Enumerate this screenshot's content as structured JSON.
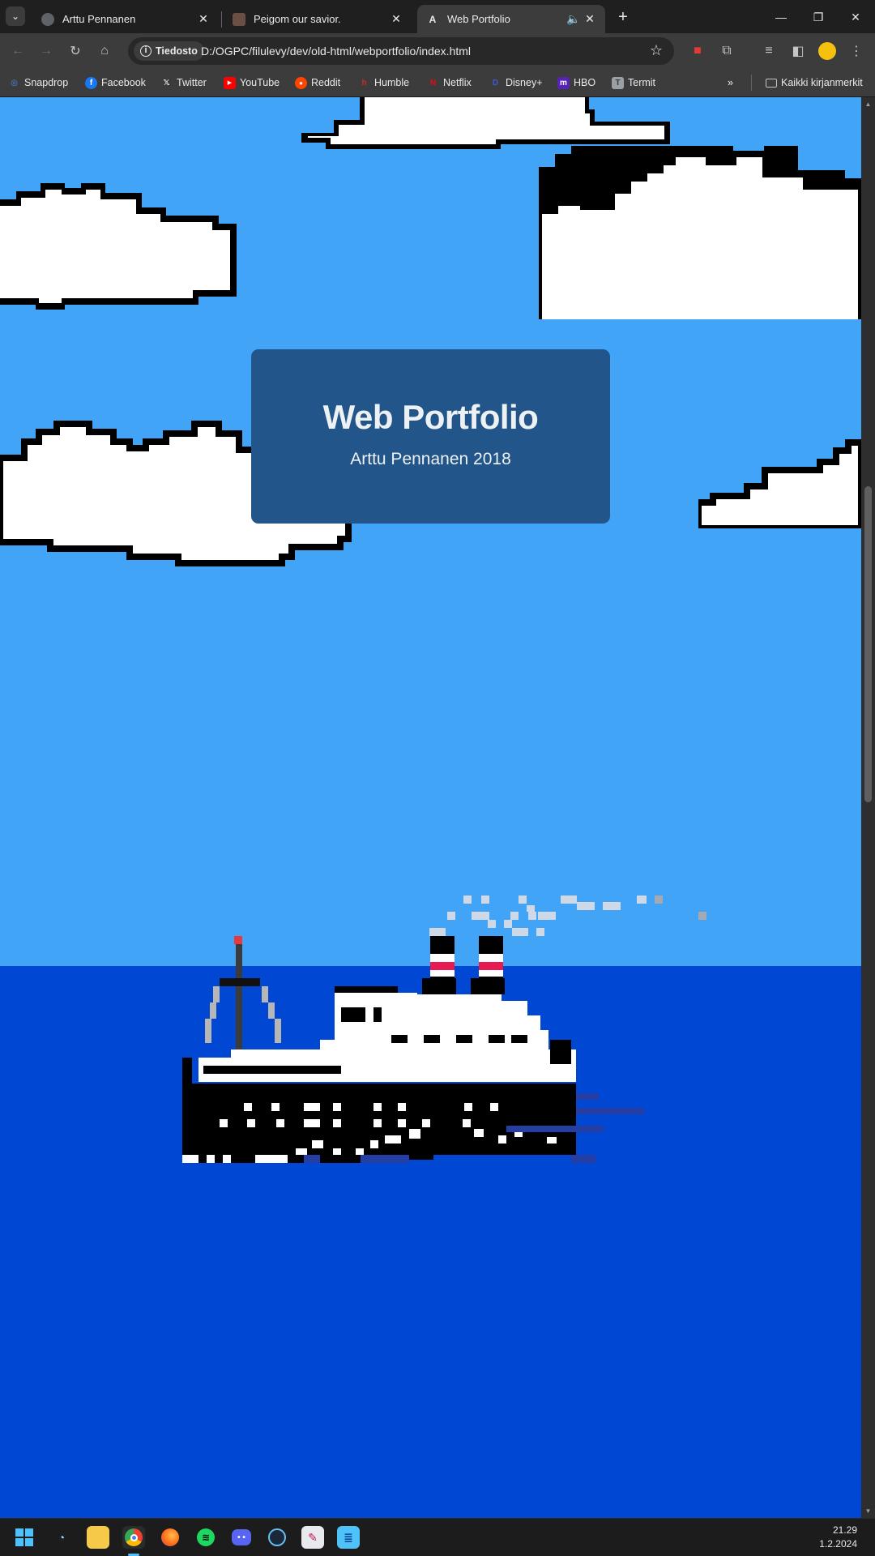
{
  "browser": {
    "tabs": [
      {
        "title": "Arttu Pennanen",
        "active": false
      },
      {
        "title": "Peigom our savior.",
        "active": false
      },
      {
        "title": "Web Portfolio",
        "active": true
      }
    ],
    "omnibox": {
      "security_label": "Tiedosto",
      "url": "D:/OGPC/filulevy/dev/old-html/webportfolio/index.html"
    },
    "bookmarks": [
      {
        "label": "Snapdrop",
        "icon": "snapdrop-icon",
        "color": "#4b8bf5"
      },
      {
        "label": "Facebook",
        "icon": "facebook-icon",
        "color": "#1877f2"
      },
      {
        "label": "Twitter",
        "icon": "x-icon",
        "color": "#000000"
      },
      {
        "label": "YouTube",
        "icon": "youtube-icon",
        "color": "#ff0000"
      },
      {
        "label": "Reddit",
        "icon": "reddit-icon",
        "color": "#ff4500"
      },
      {
        "label": "Humble",
        "icon": "humble-icon",
        "color": "#cc2929"
      },
      {
        "label": "Netflix",
        "icon": "netflix-icon",
        "color": "#e50914"
      },
      {
        "label": "Disney+",
        "icon": "disney-icon",
        "color": "#1a3aa8"
      },
      {
        "label": "HBO",
        "icon": "hbo-icon",
        "color": "#5822b4"
      },
      {
        "label": "Termit",
        "icon": "termit-icon",
        "color": "#9aa0a6"
      }
    ],
    "all_bookmarks_label": "Kaikki kirjanmerkit"
  },
  "page": {
    "title": "Web Portfolio",
    "subtitle": "Arttu Pennanen 2018",
    "colors": {
      "sky": "#42a4f6",
      "sea": "#0048d4",
      "card": "#22558a"
    }
  },
  "taskbar": {
    "time": "21.29",
    "date": "1.2.2024"
  }
}
